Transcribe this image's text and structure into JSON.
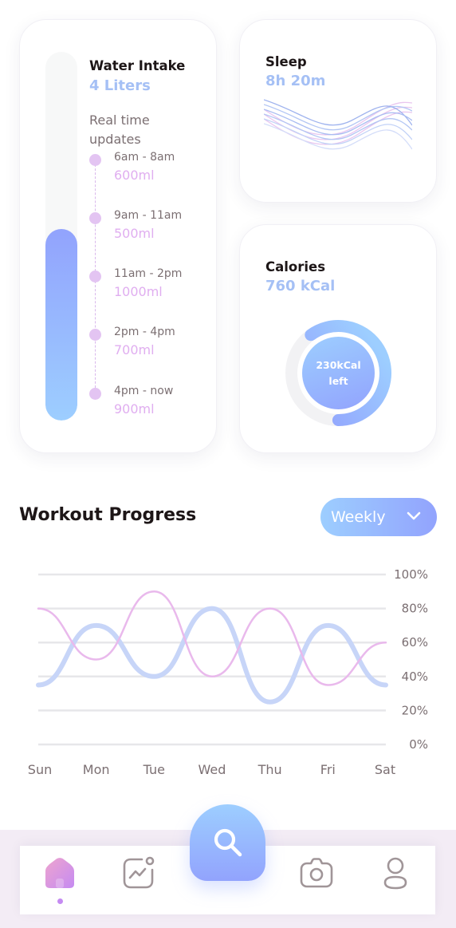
{
  "water": {
    "title": "Water Intake",
    "value": "4 Liters",
    "fill_fraction": 0.52,
    "realtime_label": "Real time updates",
    "timeline": [
      {
        "time": "6am - 8am",
        "amount": "600ml"
      },
      {
        "time": "9am - 11am",
        "amount": "500ml"
      },
      {
        "time": "11am - 2pm",
        "amount": "1000ml"
      },
      {
        "time": "2pm - 4pm",
        "amount": "700ml"
      },
      {
        "time": "4pm - now",
        "amount": "900ml"
      }
    ]
  },
  "sleep": {
    "title": "Sleep",
    "value": "8h 20m"
  },
  "calories": {
    "title": "Calories",
    "value": "760 kCal",
    "center_label": "230kCal left",
    "consumed_fraction": 0.6
  },
  "workout": {
    "title": "Workout Progress",
    "period_label": "Weekly"
  },
  "chart_data": {
    "type": "line",
    "title": "",
    "categories": [
      "Sun",
      "Mon",
      "Tue",
      "Wed",
      "Thu",
      "Fri",
      "Sat"
    ],
    "y_tick_labels": [
      "100%",
      "80%",
      "60%",
      "40%",
      "20%",
      "0%"
    ],
    "ylim": [
      0,
      100
    ],
    "grid": true,
    "series": [
      {
        "values": [
          35,
          70,
          40,
          80,
          25,
          70,
          35
        ],
        "color": "#c7d5f8"
      },
      {
        "values": [
          80,
          50,
          90,
          40,
          80,
          35,
          60
        ],
        "color": "#e9b9ec"
      }
    ]
  },
  "nav": {
    "items": [
      "home-icon",
      "activity-icon",
      "search-icon",
      "camera-icon",
      "profile-icon"
    ],
    "active": "home-icon"
  },
  "colors": {
    "brand_blue_light": "#9dceff",
    "brand_blue": "#92a3fd",
    "accent_purple": "#c58bf2",
    "text_dark": "#1d1617",
    "text_gray": "#7b6f72"
  }
}
